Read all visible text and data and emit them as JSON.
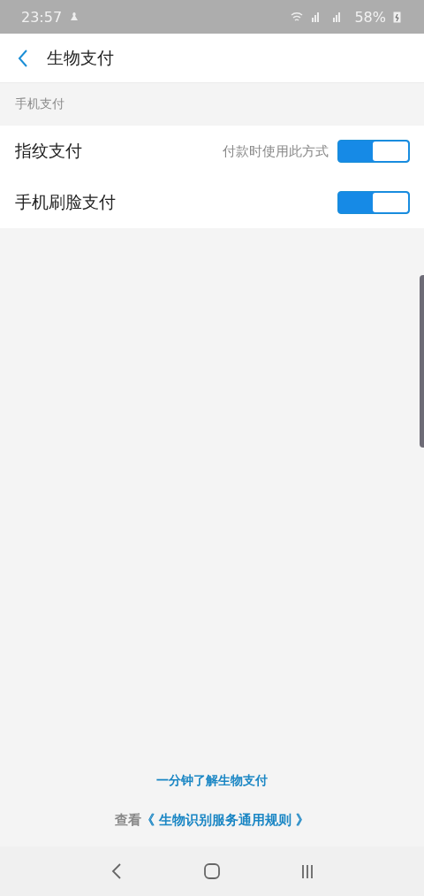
{
  "status_bar": {
    "time": "23:57",
    "battery": "58%"
  },
  "header": {
    "title": "生物支付"
  },
  "section": {
    "title": "手机支付",
    "rows": [
      {
        "label": "指纹支付",
        "hint": "付款时使用此方式",
        "on": true
      },
      {
        "label": "手机刷脸支付",
        "on": true
      }
    ]
  },
  "footer": {
    "intro_link": "一分钟了解生物支付",
    "rules_prefix": "查看",
    "rules_link": "《 生物识别服务通用规则 》"
  }
}
